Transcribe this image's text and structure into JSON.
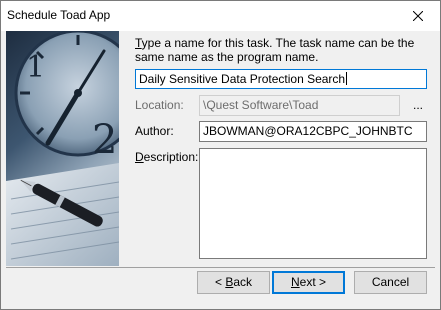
{
  "window": {
    "title": "Schedule Toad App",
    "close_icon": "close-icon"
  },
  "prompt": {
    "text": "Type a name for this task.  The task name can be the same name as the program name.",
    "first_char": "T",
    "rest": "ype a name for this task.  The task name can be the same name as the program name."
  },
  "task_name": {
    "value": "Daily Sensitive Data Protection Search"
  },
  "location": {
    "label": "Location:",
    "value": "\\Quest Software\\Toad",
    "browse_label": "..."
  },
  "author": {
    "label": "Author:",
    "value": "JBOWMAN@ORA12CBPC_JOHNBTC"
  },
  "description": {
    "label_first": "D",
    "label_rest": "escription:",
    "value": ""
  },
  "buttons": {
    "back_prefix": "< ",
    "back_u": "B",
    "back_rest": "ack",
    "next_u": "N",
    "next_rest": "ext >",
    "cancel": "Cancel"
  },
  "colors": {
    "focus_border": "#0078d7",
    "art_dark": "#2a3f55"
  }
}
